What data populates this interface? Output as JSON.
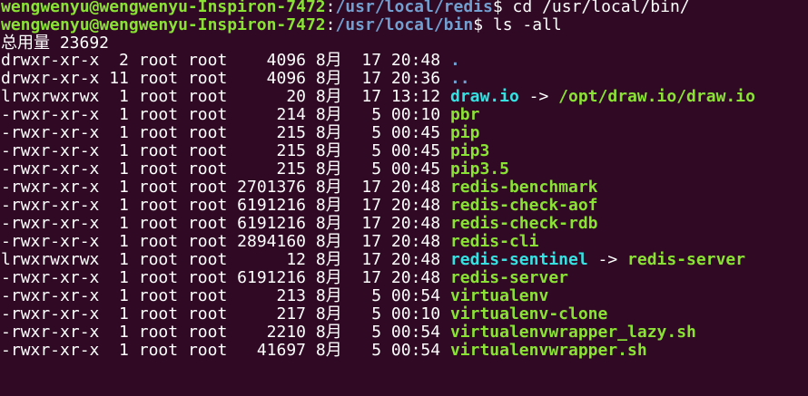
{
  "window": {
    "title": ""
  },
  "colors": {
    "background": "#300a24",
    "text": "#ffffff",
    "prompt_user": "#8ae234",
    "prompt_path": "#729fcf",
    "directory": "#729fcf",
    "symlink": "#34e2e2",
    "executable": "#8ae234"
  },
  "commands": [
    {
      "user_host": "wengwenyu@wengwenyu-Inspiron-7472",
      "sep": ":",
      "path": "/usr/local/redis",
      "symbol": "$ ",
      "command": "cd /usr/local/bin/"
    },
    {
      "user_host": "wengwenyu@wengwenyu-Inspiron-7472",
      "sep": ":",
      "path": "/usr/local/bin",
      "symbol": "$ ",
      "command": "ls -all"
    }
  ],
  "total_line": "总用量 23692",
  "listing": [
    {
      "perms": "drwxr-xr-x",
      "links": " 2",
      "owner": "root",
      "group": "root",
      "size": "   4096",
      "month": "8月",
      "day": "17",
      "time": "20:48",
      "name": ".",
      "type": "dir",
      "target": "",
      "target_type": ""
    },
    {
      "perms": "drwxr-xr-x",
      "links": "11",
      "owner": "root",
      "group": "root",
      "size": "   4096",
      "month": "8月",
      "day": "17",
      "time": "20:36",
      "name": "..",
      "type": "dir",
      "target": "",
      "target_type": ""
    },
    {
      "perms": "lrwxrwxrwx",
      "links": " 1",
      "owner": "root",
      "group": "root",
      "size": "     20",
      "month": "8月",
      "day": "17",
      "time": "13:12",
      "name": "draw.io",
      "type": "link",
      "target": "/opt/draw.io/draw.io",
      "target_type": "exec"
    },
    {
      "perms": "-rwxr-xr-x",
      "links": " 1",
      "owner": "root",
      "group": "root",
      "size": "    214",
      "month": "8月",
      "day": " 5",
      "time": "00:10",
      "name": "pbr",
      "type": "exec",
      "target": "",
      "target_type": ""
    },
    {
      "perms": "-rwxr-xr-x",
      "links": " 1",
      "owner": "root",
      "group": "root",
      "size": "    215",
      "month": "8月",
      "day": " 5",
      "time": "00:45",
      "name": "pip",
      "type": "exec",
      "target": "",
      "target_type": ""
    },
    {
      "perms": "-rwxr-xr-x",
      "links": " 1",
      "owner": "root",
      "group": "root",
      "size": "    215",
      "month": "8月",
      "day": " 5",
      "time": "00:45",
      "name": "pip3",
      "type": "exec",
      "target": "",
      "target_type": ""
    },
    {
      "perms": "-rwxr-xr-x",
      "links": " 1",
      "owner": "root",
      "group": "root",
      "size": "    215",
      "month": "8月",
      "day": " 5",
      "time": "00:45",
      "name": "pip3.5",
      "type": "exec",
      "target": "",
      "target_type": ""
    },
    {
      "perms": "-rwxr-xr-x",
      "links": " 1",
      "owner": "root",
      "group": "root",
      "size": "2701376",
      "month": "8月",
      "day": "17",
      "time": "20:48",
      "name": "redis-benchmark",
      "type": "exec",
      "target": "",
      "target_type": ""
    },
    {
      "perms": "-rwxr-xr-x",
      "links": " 1",
      "owner": "root",
      "group": "root",
      "size": "6191216",
      "month": "8月",
      "day": "17",
      "time": "20:48",
      "name": "redis-check-aof",
      "type": "exec",
      "target": "",
      "target_type": ""
    },
    {
      "perms": "-rwxr-xr-x",
      "links": " 1",
      "owner": "root",
      "group": "root",
      "size": "6191216",
      "month": "8月",
      "day": "17",
      "time": "20:48",
      "name": "redis-check-rdb",
      "type": "exec",
      "target": "",
      "target_type": ""
    },
    {
      "perms": "-rwxr-xr-x",
      "links": " 1",
      "owner": "root",
      "group": "root",
      "size": "2894160",
      "month": "8月",
      "day": "17",
      "time": "20:48",
      "name": "redis-cli",
      "type": "exec",
      "target": "",
      "target_type": ""
    },
    {
      "perms": "lrwxrwxrwx",
      "links": " 1",
      "owner": "root",
      "group": "root",
      "size": "     12",
      "month": "8月",
      "day": "17",
      "time": "20:48",
      "name": "redis-sentinel",
      "type": "link",
      "target": "redis-server",
      "target_type": "exec"
    },
    {
      "perms": "-rwxr-xr-x",
      "links": " 1",
      "owner": "root",
      "group": "root",
      "size": "6191216",
      "month": "8月",
      "day": "17",
      "time": "20:48",
      "name": "redis-server",
      "type": "exec",
      "target": "",
      "target_type": ""
    },
    {
      "perms": "-rwxr-xr-x",
      "links": " 1",
      "owner": "root",
      "group": "root",
      "size": "    213",
      "month": "8月",
      "day": " 5",
      "time": "00:54",
      "name": "virtualenv",
      "type": "exec",
      "target": "",
      "target_type": ""
    },
    {
      "perms": "-rwxr-xr-x",
      "links": " 1",
      "owner": "root",
      "group": "root",
      "size": "    217",
      "month": "8月",
      "day": " 5",
      "time": "00:10",
      "name": "virtualenv-clone",
      "type": "exec",
      "target": "",
      "target_type": ""
    },
    {
      "perms": "-rwxr-xr-x",
      "links": " 1",
      "owner": "root",
      "group": "root",
      "size": "   2210",
      "month": "8月",
      "day": " 5",
      "time": "00:54",
      "name": "virtualenvwrapper_lazy.sh",
      "type": "exec",
      "target": "",
      "target_type": ""
    },
    {
      "perms": "-rwxr-xr-x",
      "links": " 1",
      "owner": "root",
      "group": "root",
      "size": "  41697",
      "month": "8月",
      "day": " 5",
      "time": "00:54",
      "name": "virtualenvwrapper.sh",
      "type": "exec",
      "target": "",
      "target_type": ""
    }
  ]
}
